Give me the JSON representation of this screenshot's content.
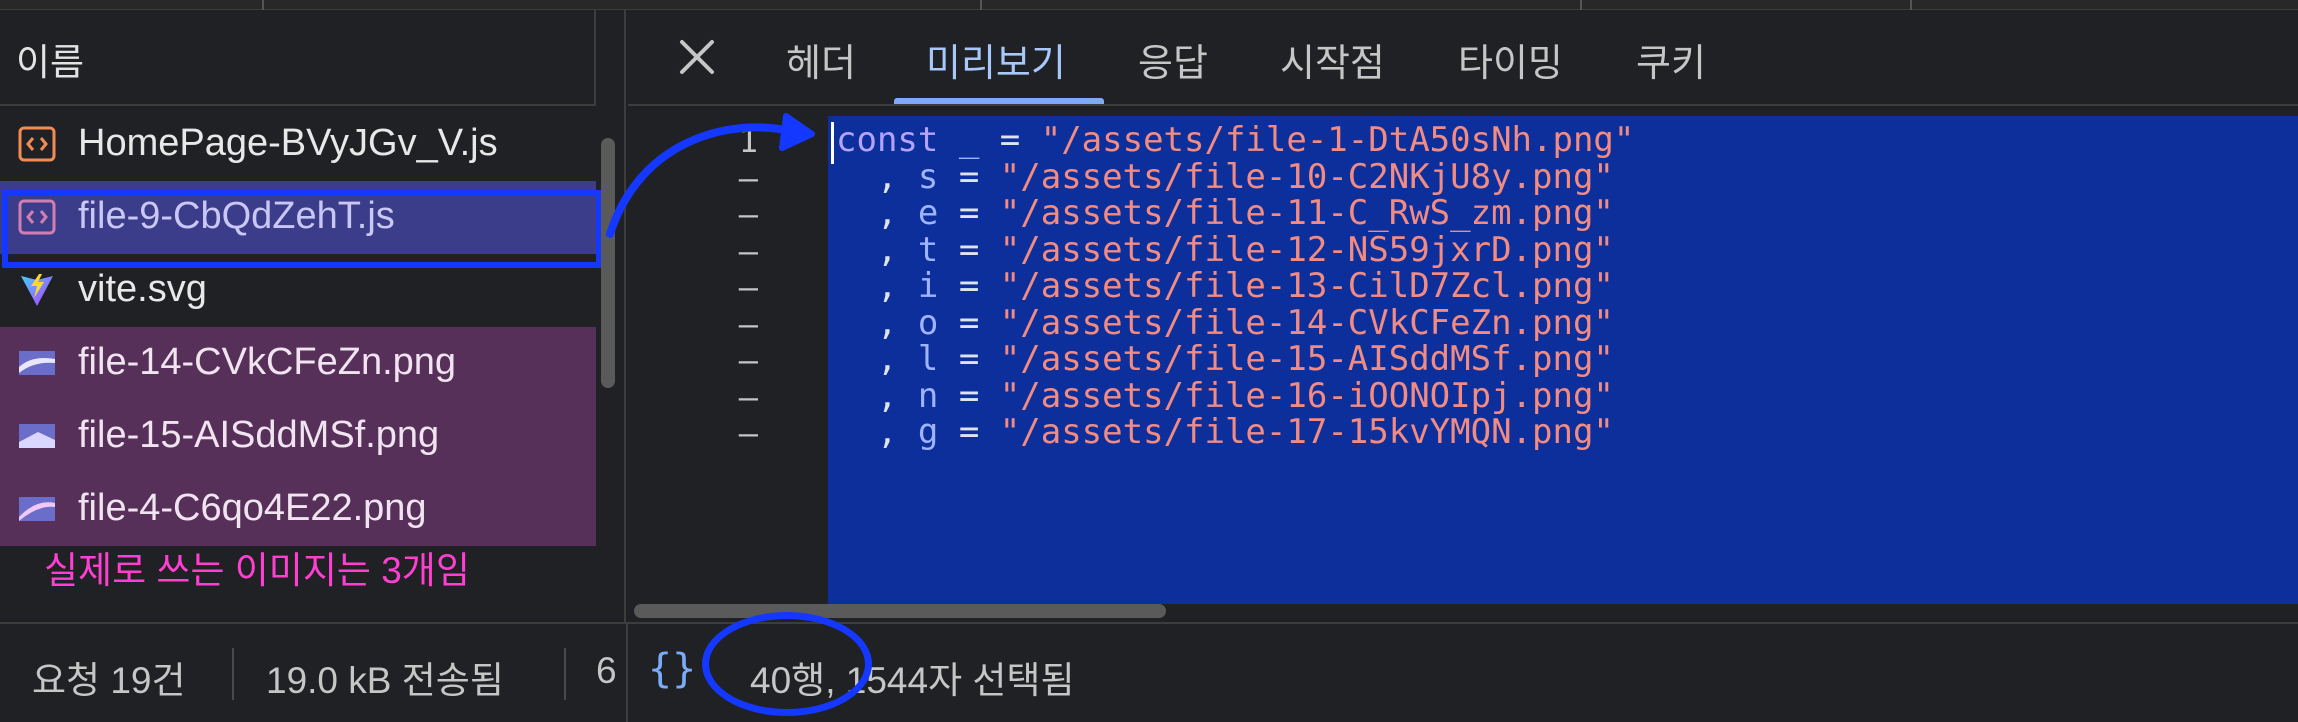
{
  "file_list": {
    "column_title": "이름",
    "files": [
      {
        "name": "HomePage-BVyJGv_V.js",
        "type": "script",
        "selected": false,
        "kind": "js"
      },
      {
        "name": "file-9-CbQdZehT.js",
        "type": "script",
        "selected": true,
        "kind": "js"
      },
      {
        "name": "vite.svg",
        "type": "svg",
        "selected": false,
        "kind": "svg"
      },
      {
        "name": "file-14-CVkCFeZn.png",
        "type": "image",
        "selected": false,
        "kind": "png"
      },
      {
        "name": "file-15-AISddMSf.png",
        "type": "image",
        "selected": false,
        "kind": "png"
      },
      {
        "name": "file-4-C6qo4E22.png",
        "type": "image",
        "selected": false,
        "kind": "png"
      }
    ],
    "annotation": "실제로 쓰는 이미지는 3개임"
  },
  "tabs": {
    "close_icon": "close-icon",
    "items": [
      "헤더",
      "미리보기",
      "응답",
      "시작점",
      "타이밍",
      "쿠키"
    ],
    "active": "미리보기"
  },
  "preview": {
    "line_numbers": [
      "1",
      "–",
      "–",
      "–",
      "–",
      "–",
      "–",
      "–",
      "–"
    ],
    "lines": [
      {
        "prefix": "",
        "keyword": "const",
        "var": "_",
        "path": "\"/assets/file-1-DtA50sNh.png\""
      },
      {
        "prefix": "  , ",
        "keyword": "",
        "var": "s",
        "path": "\"/assets/file-10-C2NKjU8y.png\""
      },
      {
        "prefix": "  , ",
        "keyword": "",
        "var": "e",
        "path": "\"/assets/file-11-C_RwS_zm.png\""
      },
      {
        "prefix": "  , ",
        "keyword": "",
        "var": "t",
        "path": "\"/assets/file-12-NS59jxrD.png\""
      },
      {
        "prefix": "  , ",
        "keyword": "",
        "var": "i",
        "path": "\"/assets/file-13-CilD7Zcl.png\""
      },
      {
        "prefix": "  , ",
        "keyword": "",
        "var": "o",
        "path": "\"/assets/file-14-CVkCFeZn.png\""
      },
      {
        "prefix": "  , ",
        "keyword": "",
        "var": "l",
        "path": "\"/assets/file-15-AISddMSf.png\""
      },
      {
        "prefix": "  , ",
        "keyword": "",
        "var": "n",
        "path": "\"/assets/file-16-iOONOIpj.png\""
      },
      {
        "prefix": "  , ",
        "keyword": "",
        "var": "g",
        "path": "\"/assets/file-17-15kvYMQN.png\""
      }
    ]
  },
  "status_bar": {
    "requests": "요청 19건",
    "transferred": "19.0 kB 전송됨",
    "truncated": "6",
    "pretty_print_icon": "{}",
    "selection": "40행, 1544자 선택됨"
  },
  "colors": {
    "annotation": "#ff3fd2",
    "highlight": "#1438ff",
    "selection_bg": "#0d2f9c",
    "active_tab": "#a8c7fa"
  }
}
